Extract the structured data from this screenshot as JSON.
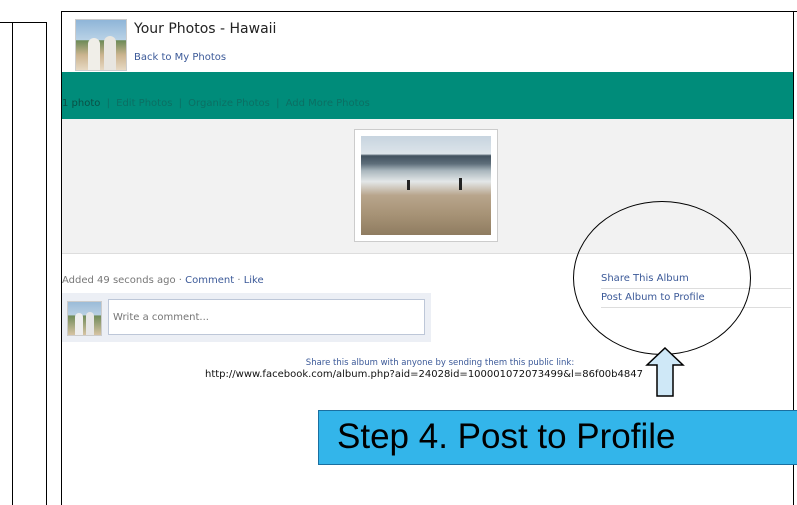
{
  "header": {
    "title": "Your Photos - Hawaii",
    "back_link": "Back to My Photos"
  },
  "tabs": {
    "photo_count": "1 photo",
    "links": [
      "Edit Photos",
      "Organize Photos",
      "Add More Photos"
    ]
  },
  "photo": {
    "alt": "beach-photo"
  },
  "meta": {
    "added": "Added 49 seconds ago",
    "dot": " · ",
    "comment": "Comment",
    "like": "Like"
  },
  "comment_box": {
    "placeholder": "Write a comment..."
  },
  "actions": {
    "share_album": "Share This Album",
    "post_album": "Post Album to Profile"
  },
  "share": {
    "text": "Share this album with anyone by sending them this public link:",
    "link": "http://www.facebook.com/album.php?aid=24028id=100001072073499&l=86f00b4847"
  },
  "step_banner": {
    "text": "Step 4. Post to Profile"
  },
  "colors": {
    "tab_bar": "#008c7a",
    "link": "#3b5998",
    "banner": "#33b5ea"
  }
}
